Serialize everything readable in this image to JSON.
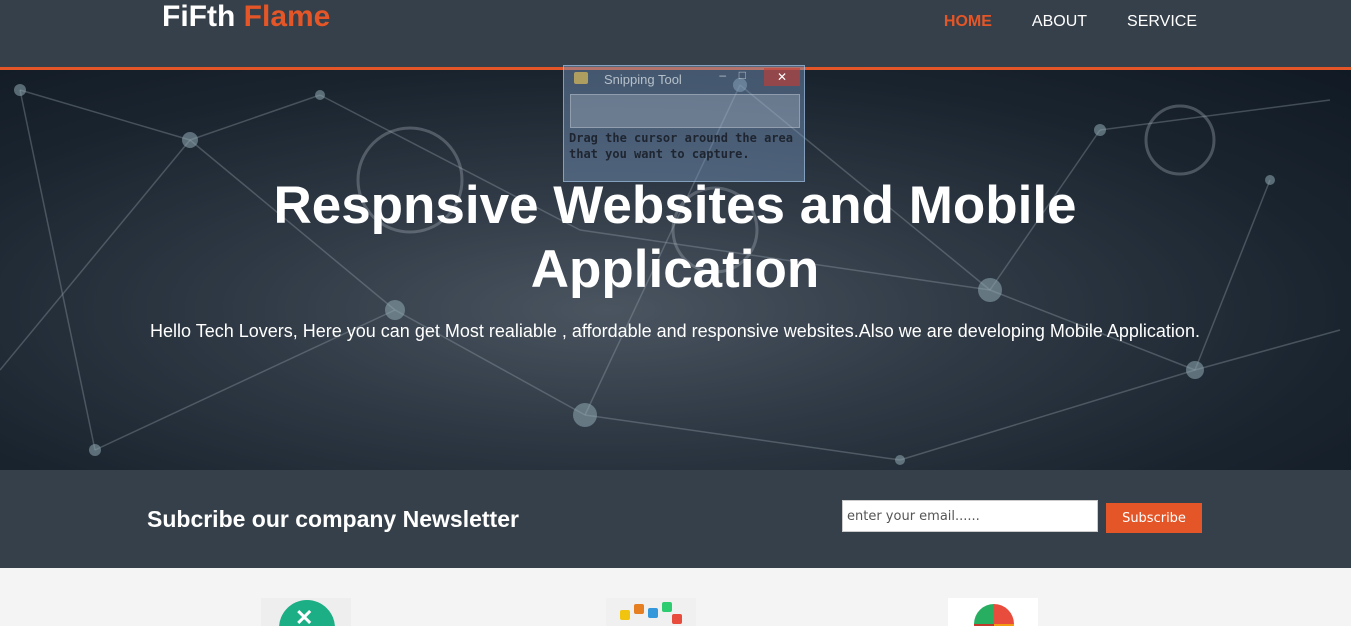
{
  "header": {
    "logo_main": "FiFth",
    "logo_accent": "Flame",
    "nav": [
      {
        "label": "HOME",
        "active": true
      },
      {
        "label": "ABOUT",
        "active": false
      },
      {
        "label": "SERVICE",
        "active": false
      }
    ]
  },
  "hero": {
    "title": "Respnsive Websites and Mobile Application",
    "subtitle": "Hello Tech Lovers, Here you can get Most realiable , affordable and responsive websites.Also we are developing Mobile Application."
  },
  "snipping_tool": {
    "title": "Snipping Tool",
    "minimize": "–",
    "maximize": "□",
    "close": "✕",
    "message": "Drag the cursor around the area that you want to capture."
  },
  "newsletter": {
    "title": "Subcribe our company Newsletter",
    "email_placeholder": "enter your email......",
    "button_label": "Subscribe"
  },
  "features": [
    {
      "icon": "tools-circle-icon"
    },
    {
      "icon": "mobile-apps-icon"
    },
    {
      "icon": "colorful-leaf-icon"
    }
  ],
  "colors": {
    "accent": "#e45627",
    "header_bg": "#35404a",
    "text_light": "#ffffff"
  }
}
